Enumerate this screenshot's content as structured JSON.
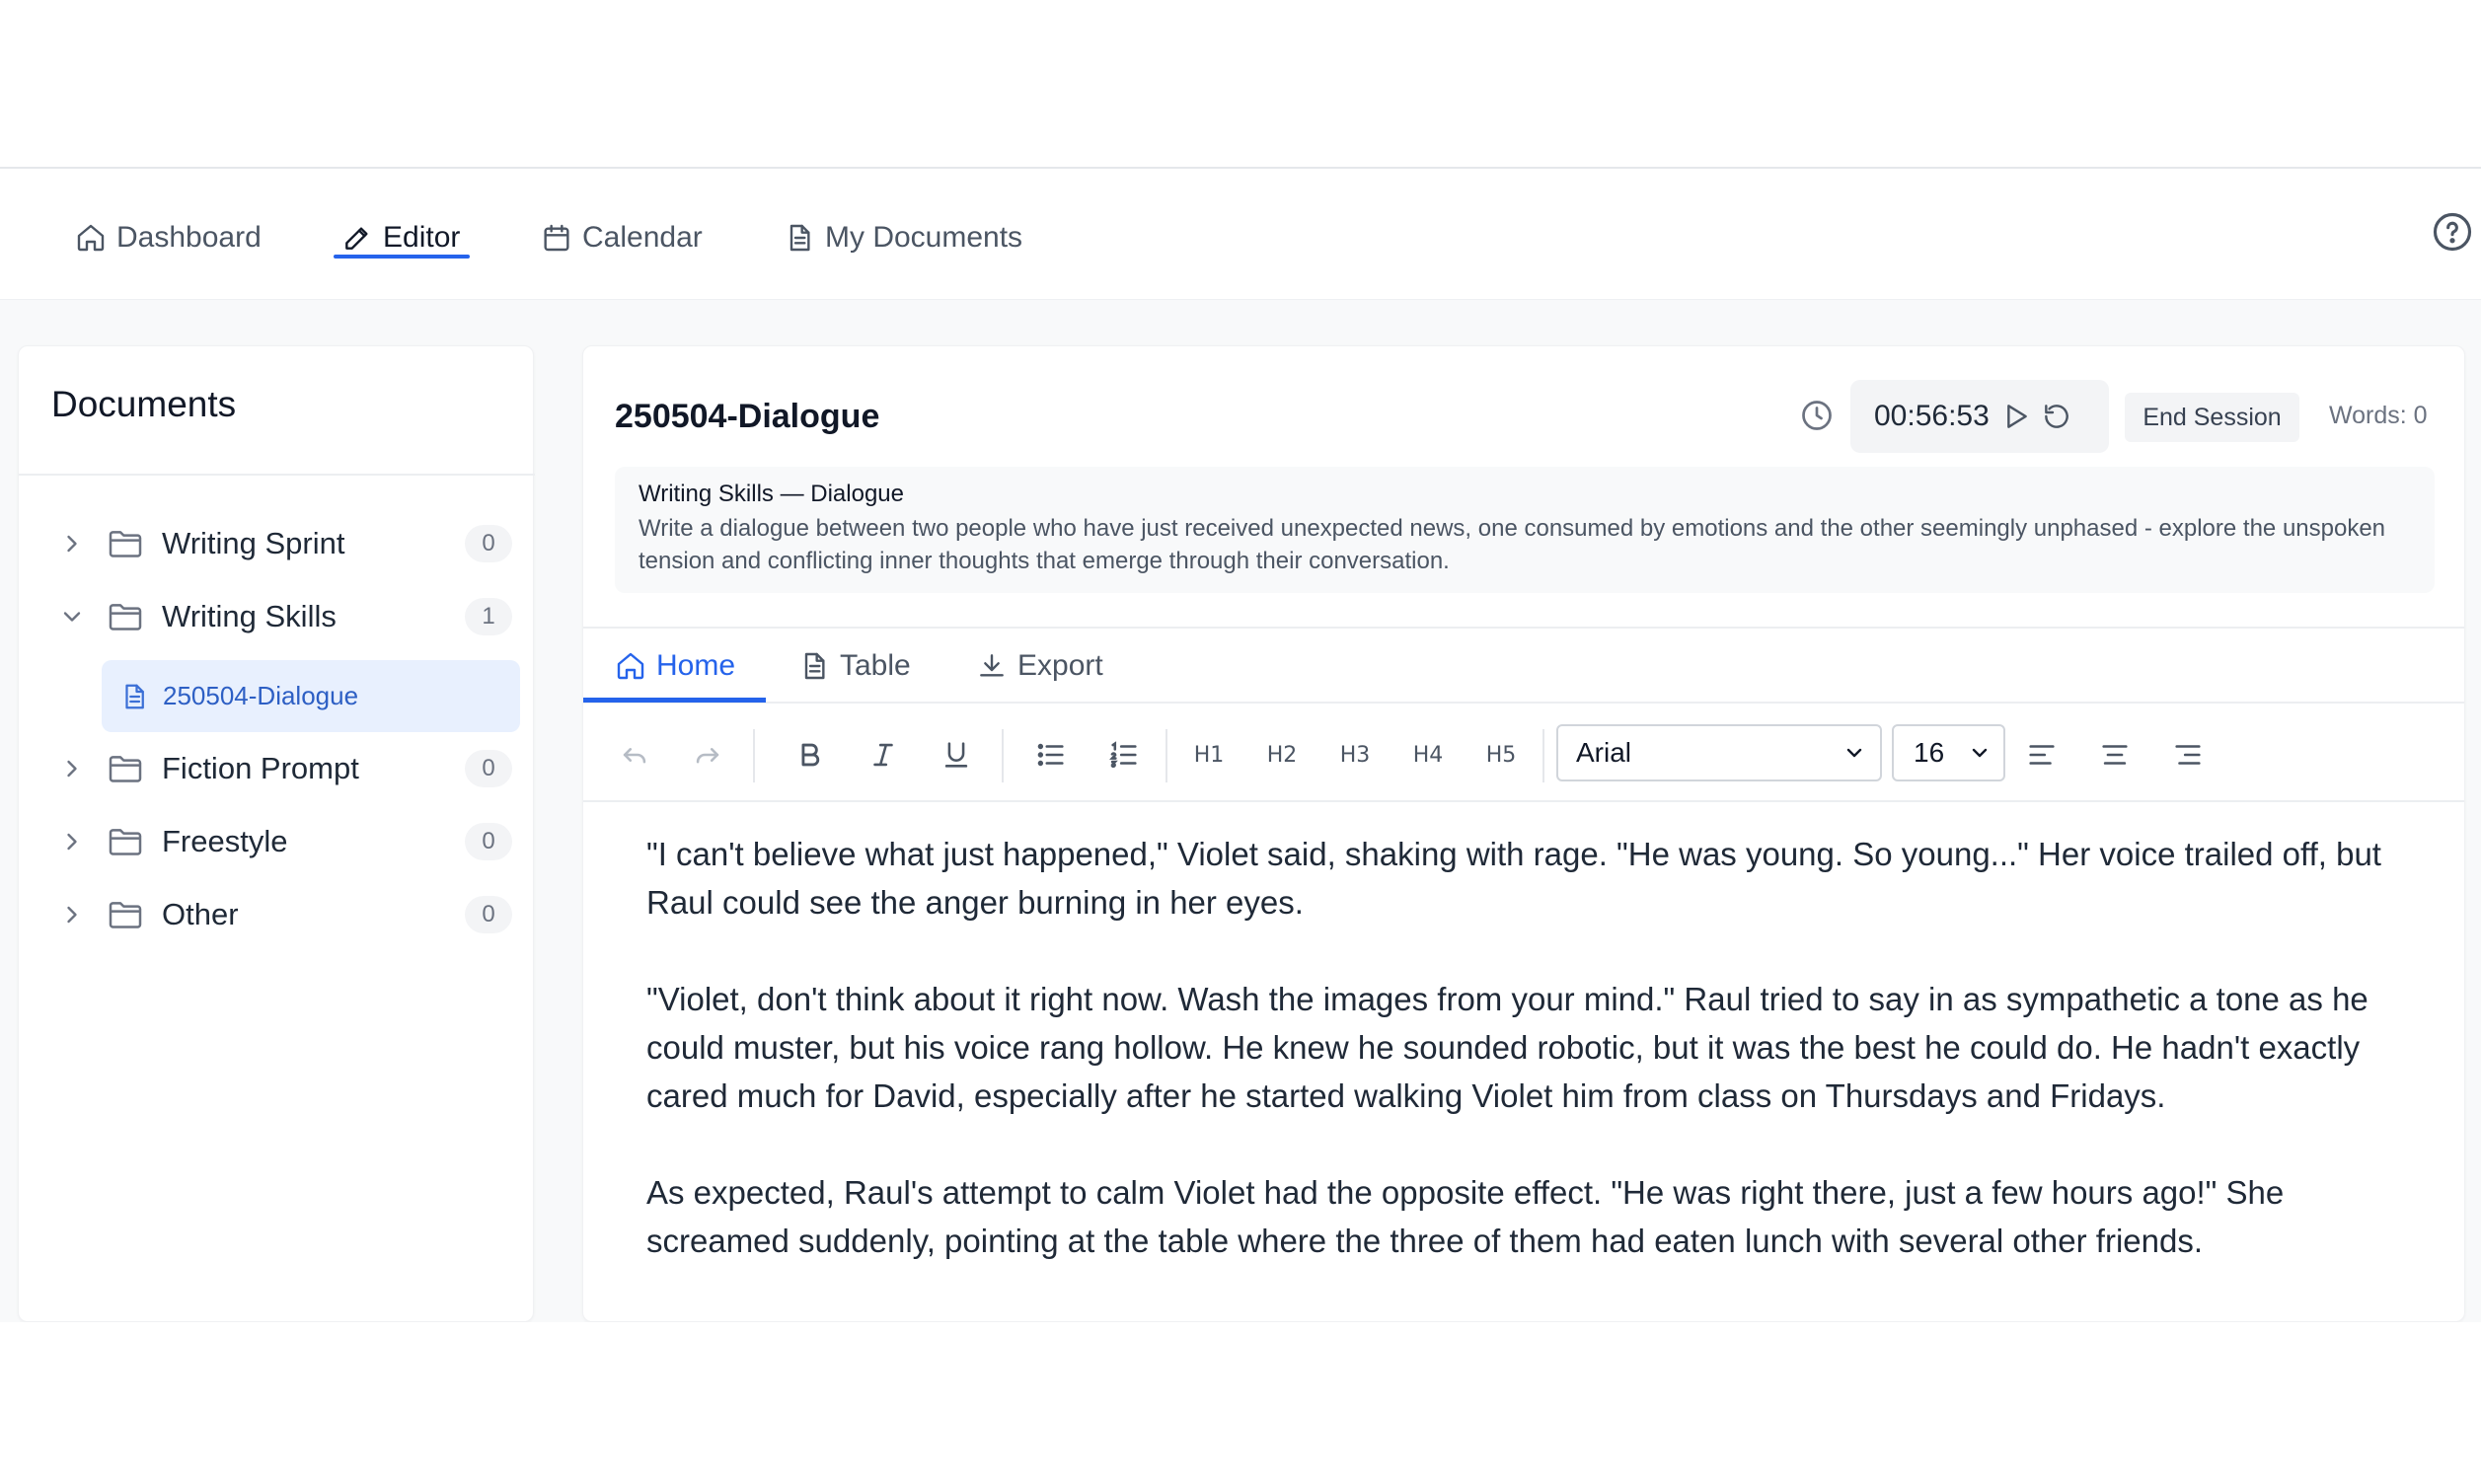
{
  "nav": {
    "items": [
      {
        "label": "Dashboard",
        "icon": "home-icon"
      },
      {
        "label": "Editor",
        "icon": "pencil-icon",
        "active": true
      },
      {
        "label": "Calendar",
        "icon": "calendar-icon"
      },
      {
        "label": "My Documents",
        "icon": "document-icon"
      }
    ],
    "help_icon": "help-circle-icon"
  },
  "sidebar": {
    "title": "Documents",
    "folders": [
      {
        "label": "Writing Sprint",
        "count": "0",
        "expanded": false
      },
      {
        "label": "Writing Skills",
        "count": "1",
        "expanded": true
      },
      {
        "label": "Fiction Prompt",
        "count": "0",
        "expanded": false
      },
      {
        "label": "Freestyle",
        "count": "0",
        "expanded": false
      },
      {
        "label": "Other",
        "count": "0",
        "expanded": false
      }
    ],
    "selected_document": "250504-Dialogue"
  },
  "document": {
    "title": "250504-Dialogue",
    "timer": "00:56:53",
    "end_session_label": "End Session",
    "word_count": "Words: 0",
    "prompt_title": "Writing Skills — Dialogue",
    "prompt_text": "Write a dialogue between two people who have just received unexpected news, one consumed by emotions and the other seemingly unphased - explore the unspoken tension and conflicting inner thoughts that emerge through their conversation."
  },
  "tabs": [
    {
      "label": "Home",
      "icon": "home-icon",
      "active": true
    },
    {
      "label": "Table",
      "icon": "document-icon"
    },
    {
      "label": "Export",
      "icon": "download-icon"
    }
  ],
  "toolbar": {
    "headings": [
      "H1",
      "H2",
      "H3",
      "H4",
      "H5"
    ],
    "font": "Arial",
    "font_size": "16"
  },
  "editor": {
    "paragraphs": [
      "\"I can't believe what just happened,\" Violet said, shaking with rage. \"He was young. So young...\" Her voice trailed off, but Raul could see the anger burning in her eyes.",
      "\"Violet, don't think about it right now. Wash the images from your mind.\" Raul tried to say in as sympathetic a tone as he could muster, but his voice rang hollow. He knew he sounded robotic, but it was the best he could do. He hadn't exactly cared much for David, especially after he started walking Violet him from class on Thursdays and Fridays.",
      "As expected, Raul's attempt to calm Violet had the opposite effect. \"He was right there, just a few hours ago!\" She screamed suddenly, pointing at the table where the three of them had eaten lunch with several other friends."
    ]
  },
  "colors": {
    "accent": "#2563eb",
    "selected_bg": "#e8f0fe"
  }
}
